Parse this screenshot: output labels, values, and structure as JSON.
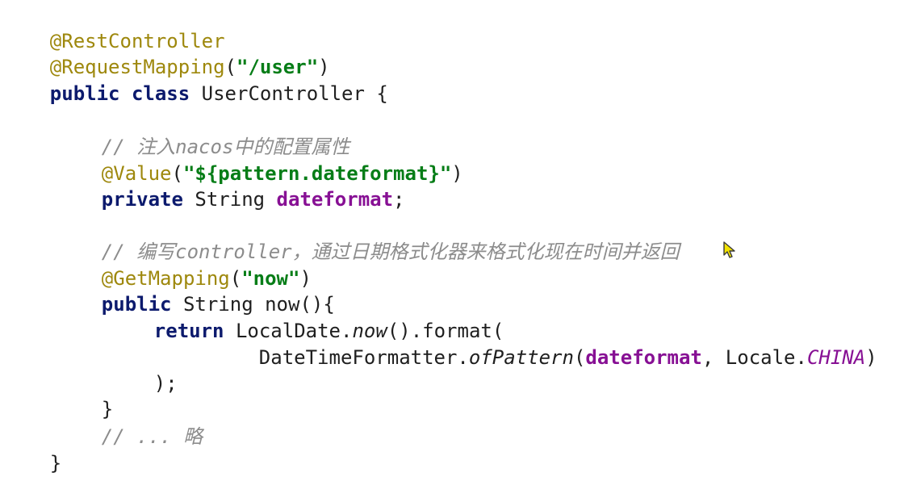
{
  "editor": {
    "lines": {
      "l1": {
        "a": "@RestController"
      },
      "l2": {
        "a": "@RequestMapping",
        "b": "(",
        "c": "\"/user\"",
        "d": ")"
      },
      "l3": {
        "a": "public",
        "b": " ",
        "c": "class",
        "d": " UserController {"
      },
      "l5": {
        "a": "// 注入nacos中的配置属性"
      },
      "l6": {
        "a": "@Value",
        "b": "(",
        "c": "\"${pattern.dateformat}\"",
        "d": ")"
      },
      "l7": {
        "a": "private",
        "b": " String ",
        "c": "dateformat",
        "d": ";"
      },
      "l9": {
        "a": "// 编写controller，通过日期格式化器来格式化现在时间并返回"
      },
      "l10": {
        "a": "@GetMapping",
        "b": "(",
        "c": "\"now\"",
        "d": ")"
      },
      "l11": {
        "a": "public",
        "b": " String now(){"
      },
      "l12": {
        "a": "return",
        "b": " LocalDate.",
        "c": "now",
        "d": "().format("
      },
      "l13": {
        "a": "DateTimeFormatter.",
        "b": "ofPattern",
        "c": "(",
        "d": "dateformat",
        "e": ", Locale.",
        "f": "CHINA",
        "g": ")"
      },
      "l14": {
        "a": ");"
      },
      "l15": {
        "a": "}"
      },
      "l16": {
        "a": "// ... 略"
      },
      "l17": {
        "a": "}"
      }
    },
    "colors": {
      "annotation": "#9e880d",
      "string": "#067d17",
      "keyword": "#0c1a6d",
      "field": "#871094",
      "comment": "#8c8c8c"
    },
    "cursor_icon": "mouse-pointer-icon"
  }
}
